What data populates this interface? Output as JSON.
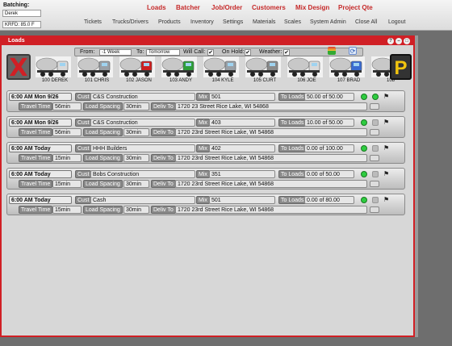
{
  "header": {
    "batching_label": "Batching:",
    "batching_value": "Derek",
    "temp_readout": "KRFD: 85.0 F",
    "primary_nav": [
      "Loads",
      "Batcher",
      "Job/Order",
      "Customers",
      "Mix Design",
      "Project Qte"
    ],
    "secondary_nav": [
      "Tickets",
      "Trucks/Drivers",
      "Products",
      "Inventory",
      "Settings",
      "Materials",
      "Scales",
      "System Admin",
      "Close All",
      "Logout"
    ]
  },
  "window": {
    "title": "Loads",
    "controls": [
      "?",
      "–",
      "□",
      "×"
    ]
  },
  "filters": {
    "from_label": "From:",
    "from_value": "-1 Week",
    "to_label": "To:",
    "to_value": "Tomorrow",
    "will_call_label": "Will Call:",
    "will_call_checked": "✔",
    "on_hold_label": "On Hold:",
    "on_hold_checked": "✔",
    "weather_label": "Weather:",
    "weather_checked": "✔"
  },
  "trucks": [
    {
      "label": "100 DEREK",
      "cab": "#d9d9d9"
    },
    {
      "label": "101 CHRIS",
      "cab": "#9aa0a6"
    },
    {
      "label": "102 JASON",
      "cab": "#cc2020"
    },
    {
      "label": "103 ANDY",
      "cab": "#2e9e3a"
    },
    {
      "label": "104 KYLE",
      "cab": "#9aa0a6"
    },
    {
      "label": "105 CURT",
      "cab": "#8a8a8a"
    },
    {
      "label": "106 JOE",
      "cab": "#d9d9d9"
    },
    {
      "label": "107 BRAD",
      "cab": "#3a6bd1"
    },
    {
      "label": "108",
      "cab": "#d9d9d9"
    }
  ],
  "truck_colors": {
    "drum": "#c8c8c8",
    "chassis": "#333333"
  },
  "labels": {
    "cust": "Cust",
    "mix": "Mix",
    "to_loads": "To Loads",
    "travel_time": "Travel Time",
    "load_spacing": "Load Spacing",
    "deliv_to": "Deliv To"
  },
  "loads": [
    {
      "time": "6:00 AM Mon 9/26",
      "cust": "C&S Construction",
      "mix": "501",
      "to_loads": "50.00 of 50.00",
      "travel_time": "56min",
      "load_spacing": "30min",
      "deliv_to": "1720 23 Street Rice Lake, WI 54868",
      "status_extra": "green"
    },
    {
      "time": "6:00 AM Mon 9/26",
      "cust": "C&S Construction",
      "mix": "403",
      "to_loads": "10.00 of 50.00",
      "travel_time": "56min",
      "load_spacing": "30min",
      "deliv_to": "1720 23rd Street Rice Lake, WI 54868",
      "status_extra": "gray"
    },
    {
      "time": "6:00 AM Today",
      "cust": "HHH Builders",
      "mix": "402",
      "to_loads": "0.00 of 100.00",
      "travel_time": "15min",
      "load_spacing": "30min",
      "deliv_to": "1720 23rd Street Rice Lake, WI 54868",
      "status_extra": "gray"
    },
    {
      "time": "6:00 AM Today",
      "cust": "Bobs Construction",
      "mix": "351",
      "to_loads": "0.00 of 50.00",
      "travel_time": "15min",
      "load_spacing": "30min",
      "deliv_to": "1720 23rd Street Rice Lake, WI 54868",
      "status_extra": "gray"
    },
    {
      "time": "6:00 AM Today",
      "cust": "Cash",
      "mix": "501",
      "to_loads": "0.00 of 80.00",
      "travel_time": "15min",
      "load_spacing": "30min",
      "deliv_to": "1720 23rd Street Rice Lake, WI 54868",
      "status_extra": "gray"
    }
  ],
  "icons": {
    "cancel": "X",
    "park": "P"
  },
  "colors": {
    "accent": "#d01f25",
    "nav_red": "#c62a2a",
    "status_green": "#2ecc40"
  }
}
